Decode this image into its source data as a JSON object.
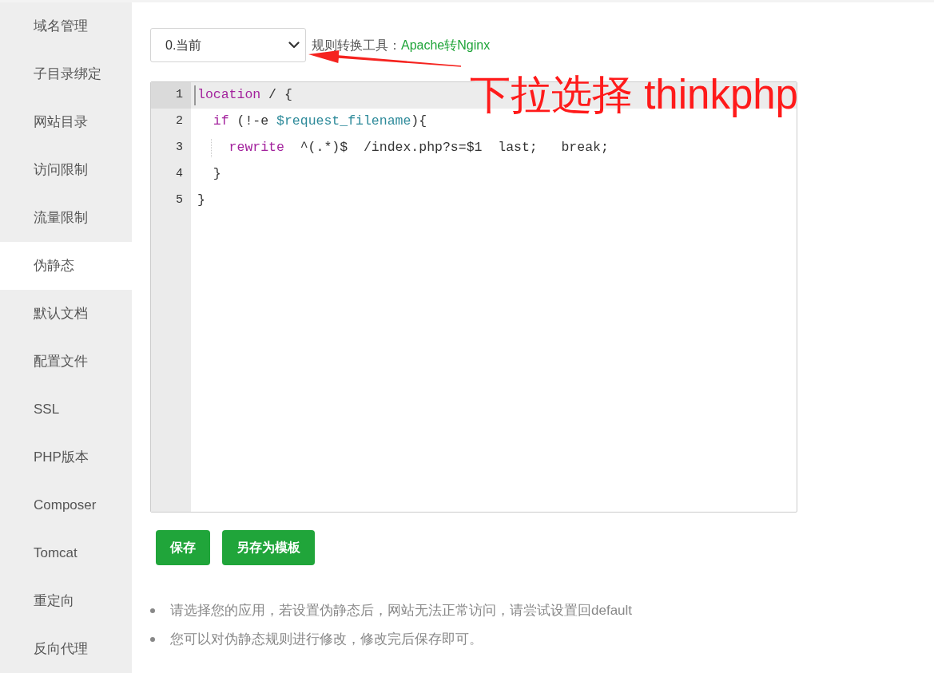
{
  "sidebar": {
    "items": [
      {
        "label": "域名管理",
        "selected": false
      },
      {
        "label": "子目录绑定",
        "selected": false
      },
      {
        "label": "网站目录",
        "selected": false
      },
      {
        "label": "访问限制",
        "selected": false
      },
      {
        "label": "流量限制",
        "selected": false
      },
      {
        "label": "伪静态",
        "selected": true
      },
      {
        "label": "默认文档",
        "selected": false
      },
      {
        "label": "配置文件",
        "selected": false
      },
      {
        "label": "SSL",
        "selected": false
      },
      {
        "label": "PHP版本",
        "selected": false
      },
      {
        "label": "Composer",
        "selected": false
      },
      {
        "label": "Tomcat",
        "selected": false
      },
      {
        "label": "重定向",
        "selected": false
      },
      {
        "label": "反向代理",
        "selected": false
      }
    ]
  },
  "rewrite_select": {
    "value": "0.当前"
  },
  "converter": {
    "label": "规则转换工具：",
    "link": "Apache转Nginx"
  },
  "annotation": {
    "text": "下拉选择 thinkphp"
  },
  "editor": {
    "lines": [
      {
        "number": "1",
        "active": true,
        "tokens": [
          {
            "kind": "keyword",
            "text": "location"
          },
          {
            "kind": "plain",
            "text": " / {"
          }
        ],
        "children": [
          {
            "number": "2",
            "active": false,
            "tokens": [
              {
                "kind": "keyword",
                "text": "if"
              },
              {
                "kind": "plain",
                "text": " (!-e "
              },
              {
                "kind": "variable",
                "text": "$request_filename"
              },
              {
                "kind": "plain",
                "text": "){"
              }
            ],
            "children": [
              {
                "number": "3",
                "active": false,
                "tokens": [
                  {
                    "kind": "keyword",
                    "text": "rewrite"
                  },
                  {
                    "kind": "plain",
                    "text": "  ^(.*)$  /index.php?s=$1  last;   break;"
                  }
                ]
              }
            ]
          },
          {
            "number": "4",
            "active": false,
            "tokens": [
              {
                "kind": "plain",
                "text": "}"
              }
            ]
          }
        ]
      },
      {
        "number": "5",
        "active": false,
        "tokens": [
          {
            "kind": "plain",
            "text": "}"
          }
        ]
      }
    ]
  },
  "buttons": [
    "保存",
    "另存为模板"
  ],
  "tips": [
    "请选择您的应用，若设置伪静态后，网站无法正常访问，请尝试设置回default",
    "您可以对伪静态规则进行修改，修改完后保存即可。"
  ]
}
